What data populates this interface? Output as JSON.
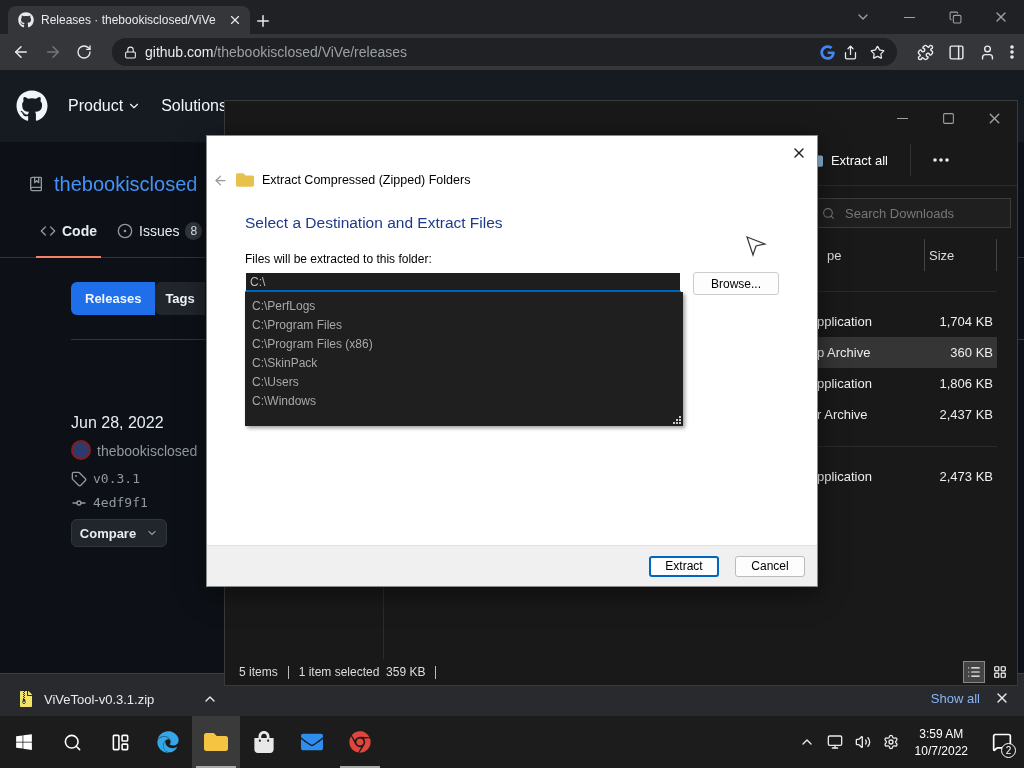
{
  "browser": {
    "tab": {
      "title": "Releases · thebookisclosed/ViVe",
      "selected": true
    },
    "url_host": "github.com",
    "url_path": "/thebookisclosed/ViVe/releases"
  },
  "github": {
    "nav": [
      "Product",
      "Solutions"
    ],
    "repo_owner": "thebookisclosed",
    "tabs": [
      {
        "label": "Code",
        "selected": true
      },
      {
        "label": "Issues",
        "count": "8",
        "selected": false
      }
    ],
    "release_tabs": [
      {
        "label": "Releases",
        "selected": true
      },
      {
        "label": "Tags",
        "selected": false
      }
    ],
    "release": {
      "date": "Jun 28, 2022",
      "author": "thebookisclosed",
      "tag": "v0.3.1",
      "commit": "4edf9f1",
      "compare": "Compare"
    }
  },
  "explorer": {
    "command": "Extract all",
    "search_placeholder": "Search Downloads",
    "columns": [
      "pe",
      "Size"
    ],
    "groups": [
      {
        "rows": [
          {
            "type": "pplication",
            "size": "1,704 KB",
            "selected": false
          },
          {
            "type": "p Archive",
            "size": "360 KB",
            "selected": true
          },
          {
            "type": "pplication",
            "size": "1,806 KB",
            "selected": false
          },
          {
            "type": "r Archive",
            "size": "2,437 KB",
            "selected": false
          }
        ]
      },
      {
        "rows": [
          {
            "type": "pplication",
            "size": "2,473 KB",
            "selected": false
          }
        ]
      }
    ],
    "status": [
      "5 items",
      "1 item selected  359 KB"
    ],
    "views": [
      {
        "kind": "details",
        "selected": true
      },
      {
        "kind": "tiles",
        "selected": false
      }
    ]
  },
  "dialog": {
    "title": "Extract Compressed (Zipped) Folders",
    "heading": "Select a Destination and Extract Files",
    "label": "Files will be extracted to this folder:",
    "value": "C:\\",
    "suggestions": [
      "C:\\PerfLogs",
      "C:\\Program Files",
      "C:\\Program Files (x86)",
      "C:\\SkinPack",
      "C:\\Users",
      "C:\\Windows"
    ],
    "browse": "Browse...",
    "buttons": [
      {
        "label": "Extract",
        "kind": "primary"
      },
      {
        "label": "Cancel",
        "kind": "secondary"
      }
    ]
  },
  "downloads": {
    "file": "ViVeTool-v0.3.1.zip",
    "show_all": "Show all"
  },
  "taskbar": {
    "apps": [
      {
        "kind": "edge",
        "selected": false,
        "running": false
      },
      {
        "kind": "explorer",
        "selected": true,
        "running": true
      },
      {
        "kind": "store",
        "selected": false,
        "running": false
      },
      {
        "kind": "mail",
        "selected": false,
        "running": false
      },
      {
        "kind": "chrome",
        "selected": false,
        "running": true
      }
    ],
    "time": "3:59 AM",
    "date": "10/7/2022",
    "notifications": "2"
  }
}
